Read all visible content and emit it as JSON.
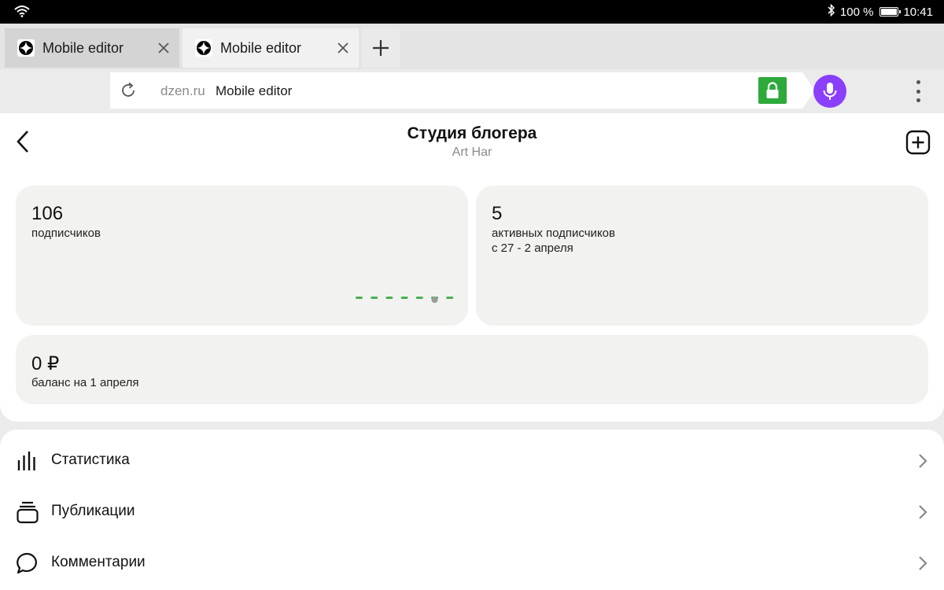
{
  "status_bar": {
    "battery": "100 %",
    "time": "10:41"
  },
  "tabs": [
    {
      "label": "Mobile editor",
      "active": false
    },
    {
      "label": "Mobile editor",
      "active": true
    }
  ],
  "address_bar": {
    "host": "dzen.ru",
    "page_title": "Mobile editor"
  },
  "header": {
    "title": "Студия блогера",
    "subtitle": "Art Har"
  },
  "cards": {
    "subscribers": {
      "value": "106",
      "label": "подписчиков",
      "sparkline_active_index": 5,
      "sparkline_points": 7
    },
    "active_subscribers": {
      "value": "5",
      "label": "активных подписчиков",
      "period": "с 27 - 2 апреля"
    },
    "balance": {
      "value": "0 ₽",
      "label": "баланс на 1 апреля"
    }
  },
  "menu": [
    {
      "label": "Статистика",
      "icon": "bar-chart-icon"
    },
    {
      "label": "Публикации",
      "icon": "stack-icon"
    },
    {
      "label": "Комментарии",
      "icon": "comment-icon"
    }
  ],
  "colors": {
    "lock": "#2eaa3b",
    "mic": "#8a3ffc",
    "sparkline": "#4caf50"
  }
}
